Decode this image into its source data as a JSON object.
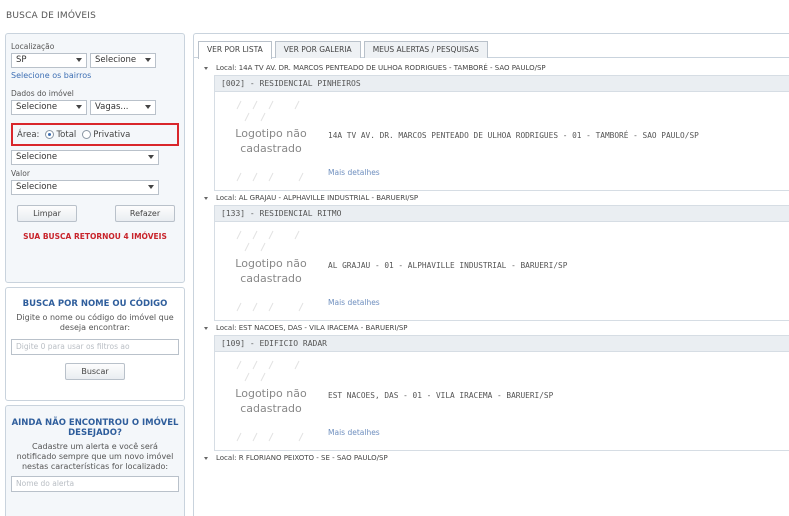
{
  "page": {
    "title": "BUSCA DE IMÓVEIS"
  },
  "sidebar": {
    "location_label": "Localização",
    "state_value": "SP",
    "city_value": "Selecione",
    "neighborhood_link": "Selecione os bairros",
    "property_label": "Dados do imóvel",
    "type_value": "Selecione",
    "rooms_value": "Vagas...",
    "area_label": "Área:",
    "area_total": "Total",
    "area_private": "Privativa",
    "area_select_value": "Selecione",
    "value_label": "Valor",
    "value_select_value": "Selecione",
    "clear_button": "Limpar",
    "redo_button": "Refazer",
    "result_message": "SUA BUSCA RETORNOU 4 IMÓVEIS",
    "name_search": {
      "title": "BUSCA POR NOME OU CÓDIGO",
      "text": "Digite o nome ou código do imóvel que deseja encontrar:",
      "placeholder": "Digite 0 para usar os filtros ao",
      "button": "Buscar"
    },
    "alert": {
      "title": "AINDA NÃO ENCONTROU O IMÓVEL DESEJADO?",
      "text": "Cadastre um alerta e você será notificado sempre que um novo imóvel nestas características for localizado:",
      "placeholder": "Nome do alerta"
    }
  },
  "tabs": [
    "VER POR LISTA",
    "VER POR GALERIA",
    "MEUS ALERTAS / PESQUISAS"
  ],
  "listing_common": {
    "logo_text": "Logotipo não cadastrado",
    "more_link": "Mais detalhes"
  },
  "groups": [
    {
      "local": "Local: 14A TV AV. DR. MARCOS PENTEADO DE ULHOA RODRIGUES - TAMBORÉ - SAO PAULO/SP",
      "title": "[002] - RESIDENCIAL PINHEIROS",
      "address": "14A TV AV. DR. MARCOS PENTEADO DE ULHOA RODRIGUES - 01 - TAMBORÉ - SAO PAULO/SP"
    },
    {
      "local": "Local: AL GRAJAU - ALPHAVILLE INDUSTRIAL - BARUERI/SP",
      "title": "[133] - RESIDENCIAL RITMO",
      "address": "AL GRAJAU - 01 - ALPHAVILLE INDUSTRIAL - BARUERI/SP"
    },
    {
      "local": "Local: EST NACOES, DAS - VILA IRACEMA - BARUERI/SP",
      "title": "[109] - EDIFICIO RADAR",
      "address": "EST NACOES, DAS - 01 - VILA IRACEMA - BARUERI/SP"
    },
    {
      "local": "Local: R FLORIANO PEIXOTO - SE - SAO PAULO/SP"
    }
  ]
}
